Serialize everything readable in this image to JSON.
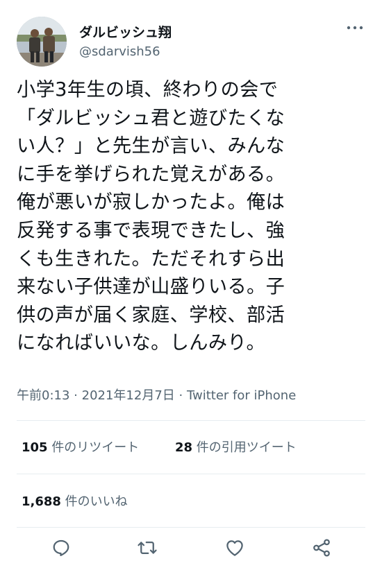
{
  "user": {
    "display_name": "ダルビッシュ翔",
    "handle": "@sdarvish56"
  },
  "tweet": {
    "text": "小学3年生の頃、終わりの会で\n「ダルビッシュ君と遊びたくな\nい人？」と先生が言い、みんな\nに手を挙げられた覚えがある。\n俺が悪いが寂しかったよ。俺は\n反発する事で表現できたし、強\nくも生きれた。ただそれすら出\n来ない子供達が山盛りいる。子\n供の声が届く家庭、学校、部活\nになればいいな。しんみり。"
  },
  "meta": {
    "time": "午前0:13",
    "separator": "·",
    "date": "2021年12月7日",
    "source": "Twitter for iPhone"
  },
  "stats": {
    "retweets_count": "105",
    "retweets_label": "件のリツイート",
    "quotes_count": "28",
    "quotes_label": "件の引用ツイート",
    "likes_count": "1,688",
    "likes_label": "件のいいね"
  },
  "icons": {
    "more": "more-icon",
    "reply": "reply-icon",
    "retweet": "retweet-icon",
    "like": "heart-icon",
    "share": "share-icon"
  },
  "colors": {
    "text_primary": "#0f1419",
    "text_secondary": "#536471",
    "divider": "#e6ecf0"
  }
}
